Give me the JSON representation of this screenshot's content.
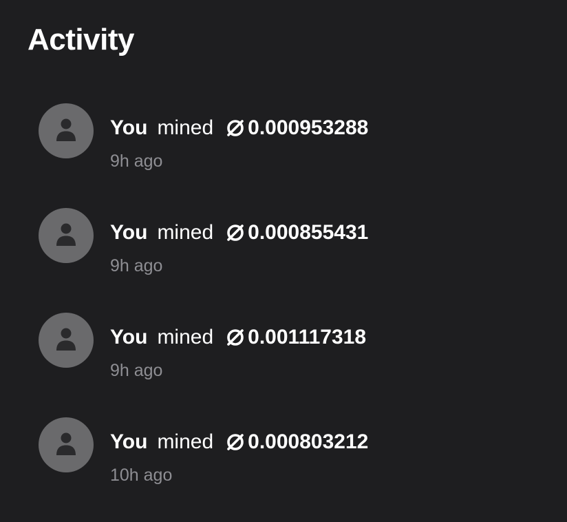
{
  "header": {
    "title": "Activity"
  },
  "activity": {
    "items": [
      {
        "actor": "You",
        "verb": "mined",
        "amount": "0.000953288",
        "time": "9h ago",
        "avatar_icon": "user-icon",
        "currency_icon": "coin-icon"
      },
      {
        "actor": "You",
        "verb": "mined",
        "amount": "0.000855431",
        "time": "9h ago",
        "avatar_icon": "user-icon",
        "currency_icon": "coin-icon"
      },
      {
        "actor": "You",
        "verb": "mined",
        "amount": "0.001117318",
        "time": "9h ago",
        "avatar_icon": "user-icon",
        "currency_icon": "coin-icon"
      },
      {
        "actor": "You",
        "verb": "mined",
        "amount": "0.000803212",
        "time": "10h ago",
        "avatar_icon": "user-icon",
        "currency_icon": "coin-icon"
      }
    ]
  },
  "colors": {
    "background": "#1e1e20",
    "avatar": "#6a6a6c",
    "avatar_figure": "#2a2a2c",
    "primary_text": "#ffffff",
    "secondary_text": "#8e8e93"
  }
}
